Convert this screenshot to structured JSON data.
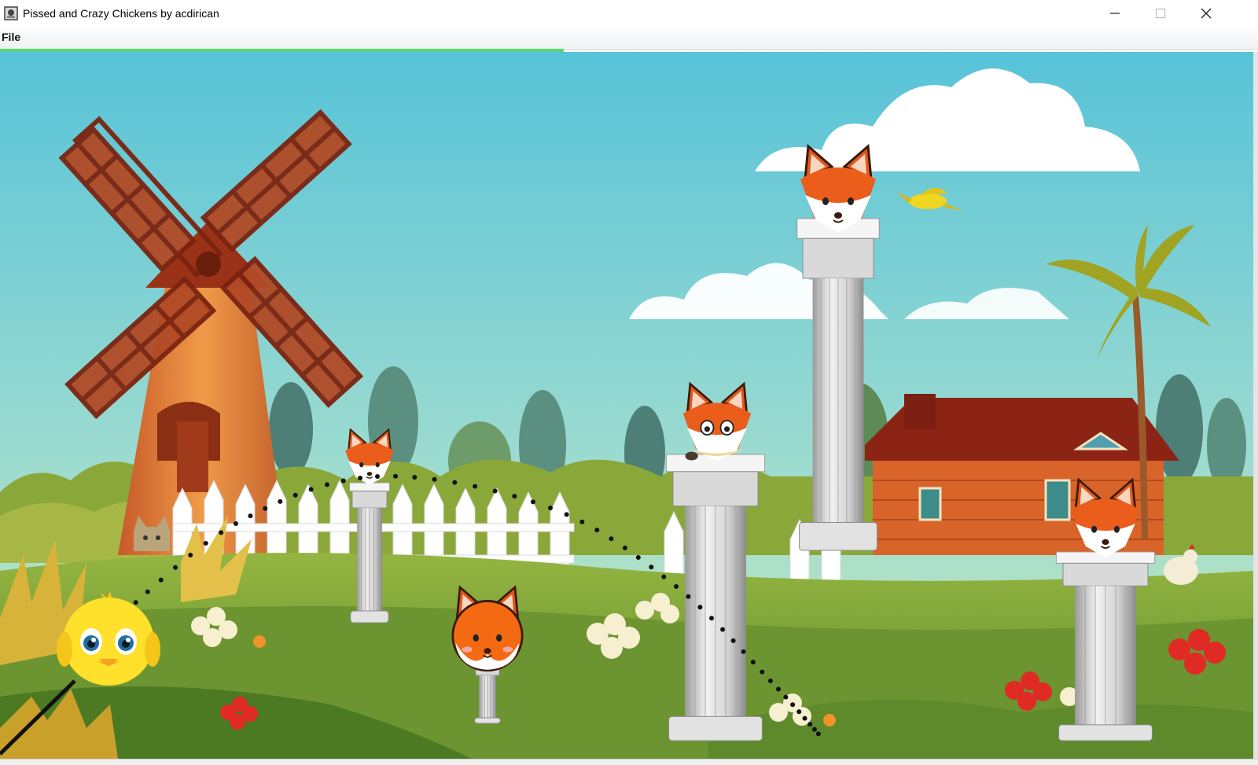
{
  "window": {
    "title": "Pissed and Crazy Chickens by acdirican",
    "app_icon": "chicken-app-icon",
    "controls": [
      "minimize-icon",
      "maximize-icon",
      "close-icon"
    ]
  },
  "menu": {
    "items": [
      {
        "label": "File"
      }
    ]
  },
  "game": {
    "loading_progress": 0.45,
    "accent_color": "#5fd37a",
    "sky_color": "#6ccfd8",
    "grass_color": "#7fa63a",
    "player": {
      "type": "yellow-chick",
      "color": "#ffe02a"
    },
    "trajectory": {
      "style": "dotted",
      "color": "#111111"
    },
    "enemies": [
      {
        "type": "fox-head",
        "on_pillar": true
      },
      {
        "type": "fox-head",
        "on_pillar": true
      },
      {
        "type": "fox-sleepy",
        "on_pillar": true
      },
      {
        "type": "fox-head",
        "on_pillar": true
      },
      {
        "type": "fox-head",
        "on_pillar": true
      }
    ],
    "scenery": [
      "windmill",
      "white-fence",
      "red-barn-house",
      "palm-tree",
      "clouds",
      "yellow-bird",
      "hedge-bushes",
      "flowers"
    ]
  }
}
